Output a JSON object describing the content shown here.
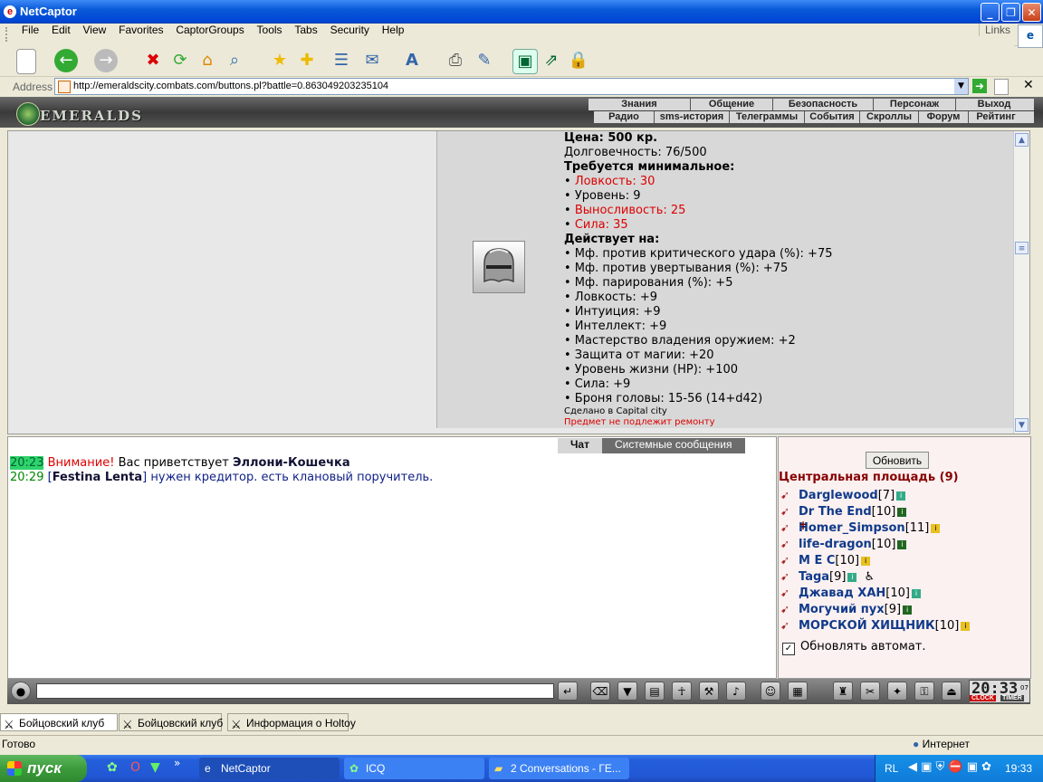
{
  "window": {
    "title": "NetCaptor",
    "minimize": "_",
    "maximize": "❐",
    "close": "✕"
  },
  "menu": {
    "items": [
      "File",
      "Edit",
      "View",
      "Favorites",
      "CaptorGroups",
      "Tools",
      "Tabs",
      "Security",
      "Help"
    ],
    "links_label": "Links"
  },
  "toolbar": {
    "icons": [
      "new-icon",
      "back-icon",
      "forward-icon",
      "stop-icon",
      "refresh-icon",
      "home-icon",
      "search-icon",
      "favorites-icon",
      "add-favorite-icon",
      "history-icon",
      "mail-icon",
      "font-icon",
      "print-icon",
      "edit-icon",
      "fullscreen-icon",
      "popup-icon",
      "lock-icon"
    ]
  },
  "address": {
    "label": "Address",
    "url": "http://emeraldscity.combats.com/buttons.pl?battle=0.863049203235104"
  },
  "game": {
    "logo": "EMERALDS",
    "nav_top": [
      "Знания",
      "Общение",
      "Безопасность",
      "Персонаж",
      "Выход"
    ],
    "nav_bottom": [
      "Радио",
      "sms-история",
      "Телеграммы",
      "События",
      "Скроллы",
      "Форум",
      "Рейтинг"
    ]
  },
  "item": {
    "price": "Цена: 500 кр.",
    "durability": "Долговечность: 76/500",
    "req_title": "Требуется минимальное:",
    "requirements": [
      {
        "text": "• ",
        "label": "Ловкость: 30",
        "unmet": true
      },
      {
        "text": "• ",
        "label": "Уровень: 9",
        "unmet": false
      },
      {
        "text": "• ",
        "label": "Выносливость: 25",
        "unmet": true
      },
      {
        "text": "• ",
        "label": "Сила: 35",
        "unmet": true
      }
    ],
    "effects_title": "Действует на:",
    "effects": [
      "• Мф. против критического удара (%): +75",
      "• Мф. против увертывания (%): +75",
      "• Мф. парирования (%): +5",
      "• Ловкость: +9",
      "• Интуиция: +9",
      "• Интеллект: +9",
      "• Мастерство владения оружием: +2",
      "• Защита от магии: +20",
      "• Уровень жизни (HP): +100",
      "• Сила: +9",
      "• Броня головы: 15-56 (14+d42)"
    ],
    "made_in": "Сделано в Capital city",
    "no_repair": "Предмет не подлежит ремонту"
  },
  "chat": {
    "tabs": [
      "Чат",
      "Системные сообщения"
    ],
    "lines": [
      {
        "time": "20:23",
        "warn": "Внимание!",
        "pre": "Вас приветствует",
        "nick": "Эллони-Кошечка",
        "msg": ""
      },
      {
        "time": "20:29",
        "warn": "",
        "pre": "[",
        "nick": "Festina Lenta",
        "msg": "] нужен кредитор. есть клановый поручитель."
      }
    ]
  },
  "users": {
    "refresh_label": "Обновить",
    "room": "Центральная площадь (9)",
    "list": [
      {
        "name": "Darglewood",
        "level": "[7]",
        "badge": "i"
      },
      {
        "name": "Dr The End",
        "level": "[10]",
        "badge": "i"
      },
      {
        "name": "Homer_Simpson",
        "level": "[11]",
        "badge": "i",
        "dead": true
      },
      {
        "name": "life-dragon",
        "level": "[10]",
        "badge": "i"
      },
      {
        "name": "M E C",
        "level": "[10]",
        "badge": "i"
      },
      {
        "name": "Taga",
        "level": "[9]",
        "badge": "i"
      },
      {
        "name": "Джавад ХАН",
        "level": "[10]",
        "badge": "i"
      },
      {
        "name": "Могучий пух",
        "level": "[9]",
        "badge": "i"
      },
      {
        "name": "МОРСКОЙ ХИЩНИК",
        "level": "[10]",
        "badge": "i"
      }
    ],
    "auto_refresh": "Обновлять автомат.",
    "auto_checked": "✓"
  },
  "clock": {
    "time": "20:33",
    "sec": "07",
    "clock_label": "CLOCK",
    "timer_label": "TIMER"
  },
  "browser_tabs": [
    "Бойцовский клуб",
    "Бойцовский клуб",
    "Информация о Holtoy"
  ],
  "status": {
    "text": "Готово",
    "zone": "Интернет"
  },
  "taskbar": {
    "start": "пуск",
    "tasks": [
      "NetCaptor",
      "ICQ",
      "2 Conversations - ГЕ..."
    ],
    "lang": "RL",
    "time": "19:33"
  }
}
